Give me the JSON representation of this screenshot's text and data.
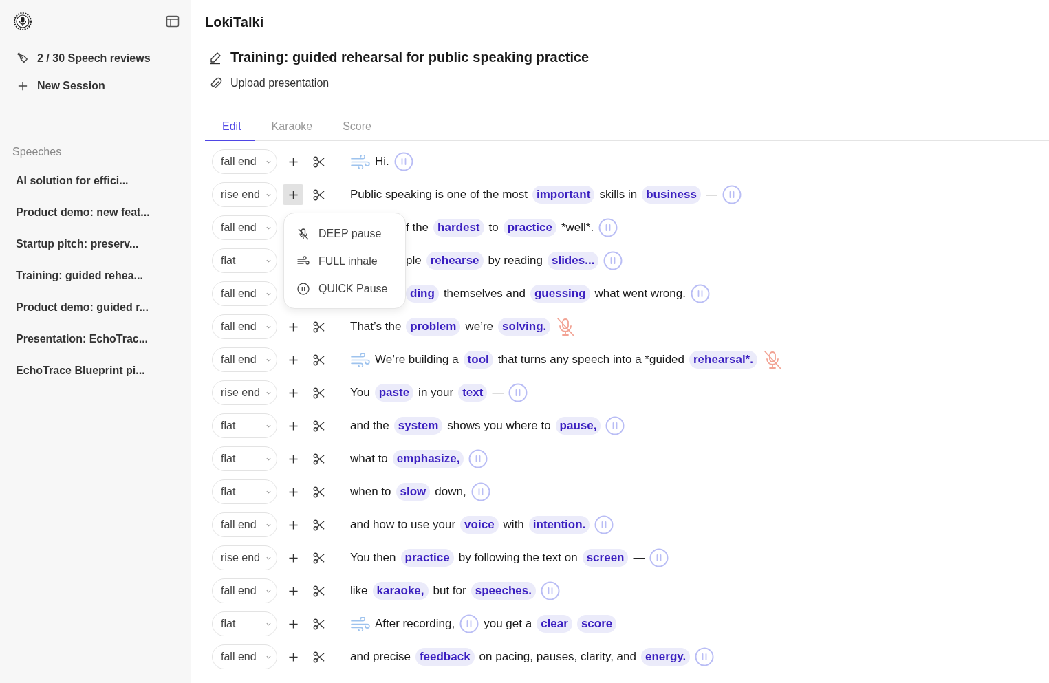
{
  "sidebar": {
    "usage": "2 / 30 Speech reviews",
    "new_session": "New Session",
    "section": "Speeches",
    "items": [
      {
        "label": "AI solution for effici...",
        "selected": false
      },
      {
        "label": "Product demo: new feat...",
        "selected": false
      },
      {
        "label": "Startup pitch: preserv...",
        "selected": false
      },
      {
        "label": "Training: guided rehea...",
        "selected": false
      },
      {
        "label": "Product demo: guided r...",
        "selected": false
      },
      {
        "label": "Presentation: EchoTrac...",
        "selected": false
      },
      {
        "label": "EchoTrace Blueprint pi...",
        "selected": false
      }
    ]
  },
  "app_name": "LokiTalki",
  "title": "Training: guided rehearsal for public speaking practice",
  "upload": "Upload presentation",
  "tabs": [
    {
      "label": "Edit",
      "selected": true
    },
    {
      "label": "Karaoke",
      "selected": false
    },
    {
      "label": "Score",
      "selected": false
    }
  ],
  "menu": {
    "items": [
      {
        "kind": "deep",
        "label": "DEEP pause"
      },
      {
        "kind": "breath",
        "label": "FULL inhale"
      },
      {
        "kind": "pause",
        "label": "QUICK Pause"
      }
    ]
  },
  "lines": [
    {
      "intonation": "fall end",
      "menu_open": false,
      "under_menu": false,
      "tokens": [
        {
          "kind": "breath"
        },
        {
          "kind": "text",
          "text": "Hi."
        },
        {
          "kind": "pause"
        }
      ]
    },
    {
      "intonation": "rise end",
      "menu_open": true,
      "under_menu": false,
      "tokens": [
        {
          "kind": "text",
          "text": "Public speaking is one of the most"
        },
        {
          "kind": "word",
          "text": "important"
        },
        {
          "kind": "text",
          "text": "skills in"
        },
        {
          "kind": "word",
          "text": "business"
        },
        {
          "kind": "text",
          "text": "—"
        },
        {
          "kind": "pause"
        }
      ]
    },
    {
      "intonation": "fall end",
      "menu_open": false,
      "under_menu": true,
      "tokens": [
        {
          "kind": "text",
          "text": "f the"
        },
        {
          "kind": "word",
          "text": "hardest"
        },
        {
          "kind": "text",
          "text": "to"
        },
        {
          "kind": "word",
          "text": "practice"
        },
        {
          "kind": "text",
          "text": "*well*."
        },
        {
          "kind": "pause"
        }
      ]
    },
    {
      "intonation": "flat",
      "menu_open": false,
      "under_menu": true,
      "tokens": [
        {
          "kind": "text",
          "text": "ple"
        },
        {
          "kind": "word",
          "text": "rehearse"
        },
        {
          "kind": "text",
          "text": "by reading"
        },
        {
          "kind": "word",
          "text": "slides..."
        },
        {
          "kind": "pause"
        }
      ]
    },
    {
      "intonation": "fall end",
      "menu_open": false,
      "under_menu": true,
      "tokens": [
        {
          "kind": "word",
          "text": "ding"
        },
        {
          "kind": "text",
          "text": "themselves and"
        },
        {
          "kind": "word",
          "text": "guessing"
        },
        {
          "kind": "text",
          "text": "what went wrong."
        },
        {
          "kind": "pause"
        }
      ]
    },
    {
      "intonation": "fall end",
      "menu_open": false,
      "under_menu": false,
      "tokens": [
        {
          "kind": "text",
          "text": "That’s the"
        },
        {
          "kind": "word",
          "text": "problem"
        },
        {
          "kind": "text",
          "text": "we’re"
        },
        {
          "kind": "word",
          "text": "solving."
        },
        {
          "kind": "deep"
        }
      ]
    },
    {
      "intonation": "fall end",
      "menu_open": false,
      "under_menu": false,
      "tokens": [
        {
          "kind": "breath"
        },
        {
          "kind": "text",
          "text": "We’re building a"
        },
        {
          "kind": "word",
          "text": "tool"
        },
        {
          "kind": "text",
          "text": "that turns any speech into a *guided"
        },
        {
          "kind": "word",
          "text": "rehearsal*."
        },
        {
          "kind": "deep"
        }
      ]
    },
    {
      "intonation": "rise end",
      "menu_open": false,
      "under_menu": false,
      "tokens": [
        {
          "kind": "text",
          "text": "You"
        },
        {
          "kind": "word",
          "text": "paste"
        },
        {
          "kind": "text",
          "text": "in your"
        },
        {
          "kind": "word",
          "text": "text"
        },
        {
          "kind": "text",
          "text": "—"
        },
        {
          "kind": "pause"
        }
      ]
    },
    {
      "intonation": "flat",
      "menu_open": false,
      "under_menu": false,
      "tokens": [
        {
          "kind": "text",
          "text": "and the"
        },
        {
          "kind": "word",
          "text": "system"
        },
        {
          "kind": "text",
          "text": "shows you where to"
        },
        {
          "kind": "word",
          "text": "pause,"
        },
        {
          "kind": "pause"
        }
      ]
    },
    {
      "intonation": "flat",
      "menu_open": false,
      "under_menu": false,
      "tokens": [
        {
          "kind": "text",
          "text": "what to"
        },
        {
          "kind": "word",
          "text": "emphasize,"
        },
        {
          "kind": "pause"
        }
      ]
    },
    {
      "intonation": "flat",
      "menu_open": false,
      "under_menu": false,
      "tokens": [
        {
          "kind": "text",
          "text": "when to"
        },
        {
          "kind": "word",
          "text": "slow"
        },
        {
          "kind": "text",
          "text": "down,"
        },
        {
          "kind": "pause"
        }
      ]
    },
    {
      "intonation": "fall end",
      "menu_open": false,
      "under_menu": false,
      "tokens": [
        {
          "kind": "text",
          "text": "and how to use your"
        },
        {
          "kind": "word",
          "text": "voice"
        },
        {
          "kind": "text",
          "text": "with"
        },
        {
          "kind": "word",
          "text": "intention."
        },
        {
          "kind": "pause"
        }
      ]
    },
    {
      "intonation": "rise end",
      "menu_open": false,
      "under_menu": false,
      "tokens": [
        {
          "kind": "text",
          "text": "You then"
        },
        {
          "kind": "word",
          "text": "practice"
        },
        {
          "kind": "text",
          "text": "by following the text on"
        },
        {
          "kind": "word",
          "text": "screen"
        },
        {
          "kind": "text",
          "text": "—"
        },
        {
          "kind": "pause"
        }
      ]
    },
    {
      "intonation": "fall end",
      "menu_open": false,
      "under_menu": false,
      "tokens": [
        {
          "kind": "text",
          "text": "like"
        },
        {
          "kind": "word",
          "text": "karaoke,"
        },
        {
          "kind": "text",
          "text": "but for"
        },
        {
          "kind": "word",
          "text": "speeches."
        },
        {
          "kind": "pause"
        }
      ]
    },
    {
      "intonation": "flat",
      "menu_open": false,
      "under_menu": false,
      "tokens": [
        {
          "kind": "breath"
        },
        {
          "kind": "text",
          "text": "After recording,"
        },
        {
          "kind": "pause"
        },
        {
          "kind": "text",
          "text": "you get a"
        },
        {
          "kind": "word",
          "text": "clear"
        },
        {
          "kind": "word",
          "text": "score"
        }
      ]
    },
    {
      "intonation": "fall end",
      "menu_open": false,
      "under_menu": false,
      "tokens": [
        {
          "kind": "text",
          "text": "and precise"
        },
        {
          "kind": "word",
          "text": "feedback"
        },
        {
          "kind": "text",
          "text": "on pacing, pauses, clarity, and"
        },
        {
          "kind": "word",
          "text": "energy."
        },
        {
          "kind": "pause"
        }
      ]
    }
  ]
}
